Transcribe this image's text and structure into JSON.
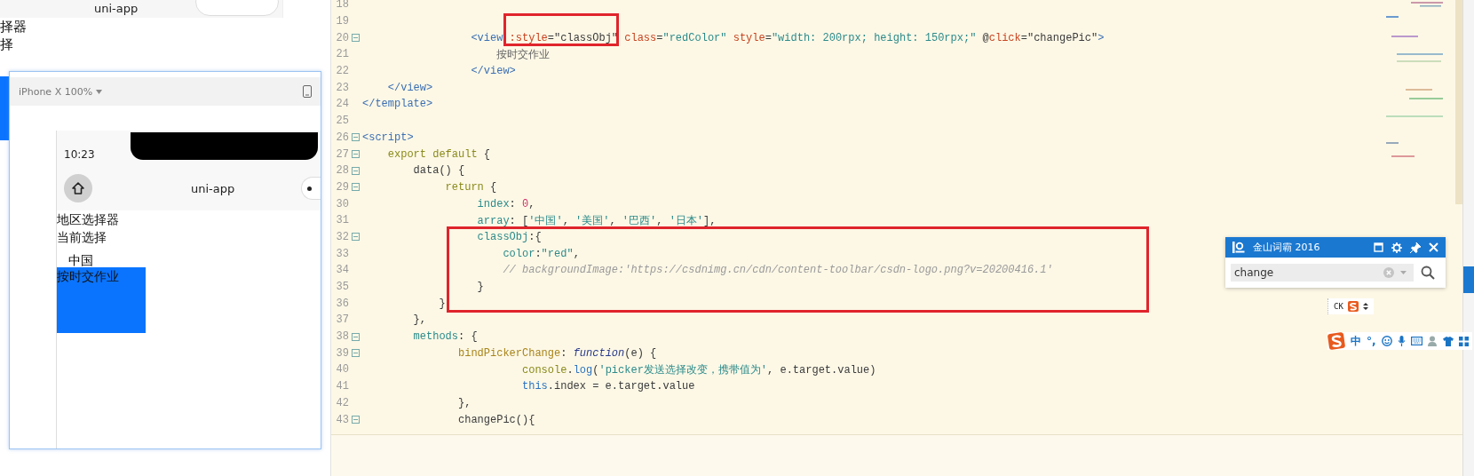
{
  "background_preview": {
    "nav_title": "uni-app",
    "lines": [
      "择器",
      "择"
    ]
  },
  "simulator": {
    "device_menu": "iPhone X 100%",
    "time": "10:23",
    "nav_title": "uni-app",
    "labels": [
      "地区选择器",
      "当前选择"
    ],
    "picker_value": "中国",
    "button_text": "按时交作业"
  },
  "editor": {
    "lines": [
      {
        "number": "18",
        "foldable": false
      },
      {
        "number": "19",
        "foldable": false
      },
      {
        "number": "20",
        "foldable": true,
        "tokens": [
          {
            "kind": "tag",
            "text": "                 <view"
          },
          {
            "kind": "attr",
            "text": " :style"
          },
          {
            "kind": "plain",
            "text": "=\"classObj\" "
          },
          {
            "kind": "attr",
            "text": "class"
          },
          {
            "kind": "plain",
            "text": "="
          },
          {
            "kind": "str",
            "text": "\"redColor\" "
          },
          {
            "kind": "attr",
            "text": "style"
          },
          {
            "kind": "plain",
            "text": "="
          },
          {
            "kind": "str",
            "text": "\"width: 200rpx; height: 150rpx;\" "
          },
          {
            "kind": "plain",
            "text": "@"
          },
          {
            "kind": "attr",
            "text": "click"
          },
          {
            "kind": "plain",
            "text": "=\"changePic\""
          },
          {
            "kind": "tag",
            "text": ">"
          }
        ]
      },
      {
        "number": "21",
        "foldable": false,
        "tokens": [
          {
            "kind": "text",
            "text": "                     按时交作业"
          }
        ]
      },
      {
        "number": "22",
        "foldable": false,
        "tokens": [
          {
            "kind": "tag",
            "text": "                 </view>"
          }
        ]
      },
      {
        "number": "23",
        "foldable": false,
        "tokens": [
          {
            "kind": "tag",
            "text": "    </view>"
          }
        ]
      },
      {
        "number": "24",
        "foldable": false,
        "tokens": [
          {
            "kind": "tag",
            "text": "</template>"
          }
        ]
      },
      {
        "number": "25",
        "foldable": false
      },
      {
        "number": "26",
        "foldable": true,
        "tokens": [
          {
            "kind": "tag",
            "text": "<script>"
          }
        ]
      },
      {
        "number": "27",
        "foldable": true,
        "tokens": [
          {
            "kind": "kw",
            "text": "    export default"
          },
          {
            "kind": "plain",
            "text": " {"
          }
        ]
      },
      {
        "number": "28",
        "foldable": true,
        "tokens": [
          {
            "kind": "plain",
            "text": "        data() {"
          }
        ]
      },
      {
        "number": "29",
        "foldable": true,
        "tokens": [
          {
            "kind": "kw",
            "text": "             return"
          },
          {
            "kind": "plain",
            "text": " {"
          }
        ]
      },
      {
        "number": "30",
        "foldable": false,
        "tokens": [
          {
            "kind": "prop",
            "text": "                  index"
          },
          {
            "kind": "plain",
            "text": ": "
          },
          {
            "kind": "num",
            "text": "0"
          },
          {
            "kind": "plain",
            "text": ","
          }
        ]
      },
      {
        "number": "31",
        "foldable": false,
        "tokens": [
          {
            "kind": "prop",
            "text": "                  array"
          },
          {
            "kind": "plain",
            "text": ": ["
          },
          {
            "kind": "str",
            "text": "'中国'"
          },
          {
            "kind": "plain",
            "text": ", "
          },
          {
            "kind": "str",
            "text": "'美国'"
          },
          {
            "kind": "plain",
            "text": ", "
          },
          {
            "kind": "str",
            "text": "'巴西'"
          },
          {
            "kind": "plain",
            "text": ", "
          },
          {
            "kind": "str",
            "text": "'日本'"
          },
          {
            "kind": "plain",
            "text": "],"
          }
        ]
      },
      {
        "number": "32",
        "foldable": true,
        "tokens": [
          {
            "kind": "prop",
            "text": "                  classObj"
          },
          {
            "kind": "plain",
            "text": ":{"
          }
        ]
      },
      {
        "number": "33",
        "foldable": false,
        "tokens": [
          {
            "kind": "prop",
            "text": "                      color"
          },
          {
            "kind": "plain",
            "text": ":"
          },
          {
            "kind": "str",
            "text": "\"red\""
          },
          {
            "kind": "plain",
            "text": ","
          }
        ]
      },
      {
        "number": "34",
        "foldable": false,
        "tokens": [
          {
            "kind": "comment",
            "text": "                      // backgroundImage:'https://csdnimg.cn/cdn/content-toolbar/csdn-logo.png?v=20200416.1'"
          }
        ]
      },
      {
        "number": "35",
        "foldable": false,
        "tokens": [
          {
            "kind": "plain",
            "text": "                  }"
          }
        ]
      },
      {
        "number": "36",
        "foldable": false,
        "tokens": [
          {
            "kind": "plain",
            "text": "            }"
          }
        ]
      },
      {
        "number": "37",
        "foldable": false,
        "tokens": [
          {
            "kind": "plain",
            "text": "        },"
          }
        ]
      },
      {
        "number": "38",
        "foldable": true,
        "tokens": [
          {
            "kind": "prop",
            "text": "        methods"
          },
          {
            "kind": "plain",
            "text": ": {"
          }
        ]
      },
      {
        "number": "39",
        "foldable": true,
        "tokens": [
          {
            "kind": "fn",
            "text": "               bindPickerChange"
          },
          {
            "kind": "plain",
            "text": ": "
          },
          {
            "kind": "italic",
            "text": "function"
          },
          {
            "kind": "plain",
            "text": "(e) {"
          }
        ]
      },
      {
        "number": "40",
        "foldable": false,
        "tokens": [
          {
            "kind": "kw",
            "text": "                         console"
          },
          {
            "kind": "plain",
            "text": "."
          },
          {
            "kind": "builtin",
            "text": "log"
          },
          {
            "kind": "plain",
            "text": "("
          },
          {
            "kind": "str",
            "text": "'picker发送选择改变，携带值为'"
          },
          {
            "kind": "plain",
            "text": ", e.target.value)"
          }
        ]
      },
      {
        "number": "41",
        "foldable": false,
        "tokens": [
          {
            "kind": "builtin",
            "text": "                         this"
          },
          {
            "kind": "plain",
            "text": ".index = e.target.value"
          }
        ]
      },
      {
        "number": "42",
        "foldable": false,
        "tokens": [
          {
            "kind": "plain",
            "text": "               },"
          }
        ]
      },
      {
        "number": "43",
        "foldable": true,
        "tokens": [
          {
            "kind": "plain",
            "text": "               changePic(){"
          }
        ]
      }
    ],
    "highlight_frames": [
      {
        "kind": "rectangle",
        "color": "#e0242c"
      },
      {
        "kind": "rectangle",
        "color": "#e0242c"
      }
    ]
  },
  "dictionary": {
    "title": "金山词霸 2016",
    "search": {
      "value": "change"
    }
  },
  "ime_status": {
    "mode": "CK"
  },
  "ime_toolbar": {
    "mode": "中",
    "punctuation": "°,"
  }
}
